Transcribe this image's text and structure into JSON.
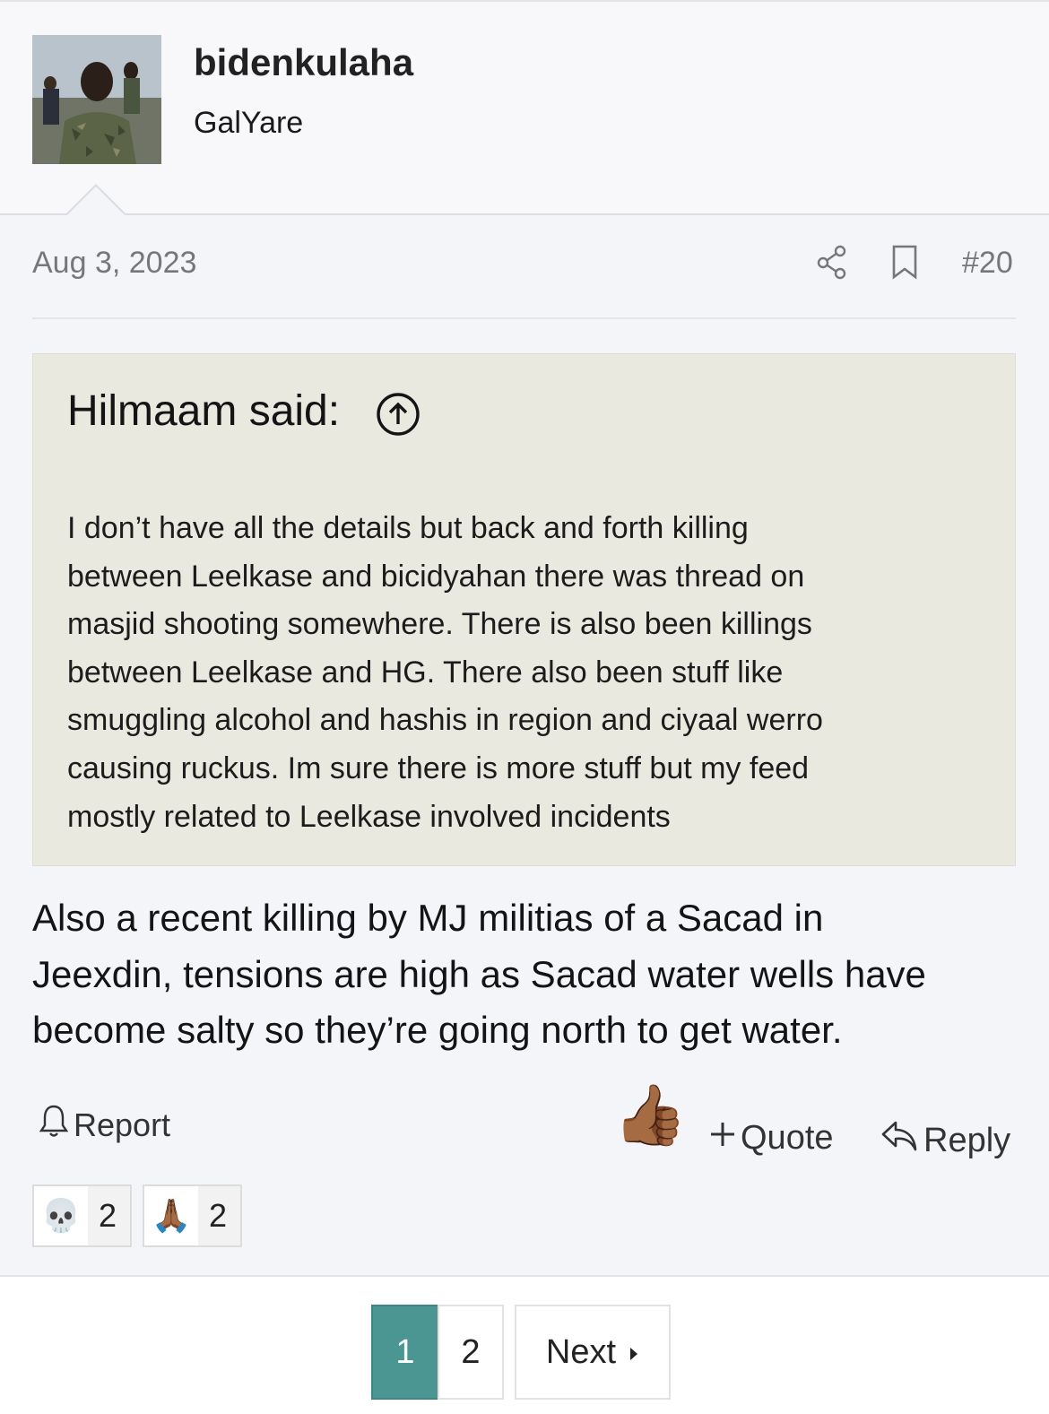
{
  "post": {
    "username": "bidenkulaha",
    "user_title": "GalYare",
    "date": "Aug 3, 2023",
    "post_number": "#20",
    "quote": {
      "title": "Hilmaam said:",
      "lines": [
        "I don’t have all the details but back and forth killing",
        "between Leelkase and bicidyahan there was thread on",
        "masjid shooting somewhere. There is also been killings",
        "between Leelkase and HG. There also been stuff like",
        "smuggling alcohol and hashis in region and ciyaal werro",
        "causing ruckus. Im sure there is more stuff but my feed",
        "mostly related to Leelkase involved incidents"
      ]
    },
    "body_lines": [
      "Also a recent killing by MJ militias of a Sacad in",
      "Jeexdin, tensions are high as Sacad water wells have",
      "become salty so they’re going north to get water."
    ]
  },
  "actions": {
    "report_label": "Report",
    "like_emoji": "👍🏾",
    "quote_label": "Quote",
    "reply_label": "Reply"
  },
  "reactions": [
    {
      "emoji": "💀",
      "count": "2"
    },
    {
      "emoji": "🙏🏾",
      "count": "2"
    }
  ],
  "pagination": {
    "pages": [
      "1",
      "2"
    ],
    "current": "1",
    "next_label": "Next"
  },
  "icons": {
    "share": "share-icon",
    "bookmark": "bookmark-icon",
    "quote_arrow": "arrow-up-circle-icon",
    "report": "bell-icon",
    "quote_plus": "plus-icon",
    "reply": "reply-arrow-icon",
    "next": "caret-right-icon"
  },
  "colors": {
    "quote_bg": "#e9e9df",
    "pager_active": "#4b9592",
    "meta_text": "#777777"
  }
}
